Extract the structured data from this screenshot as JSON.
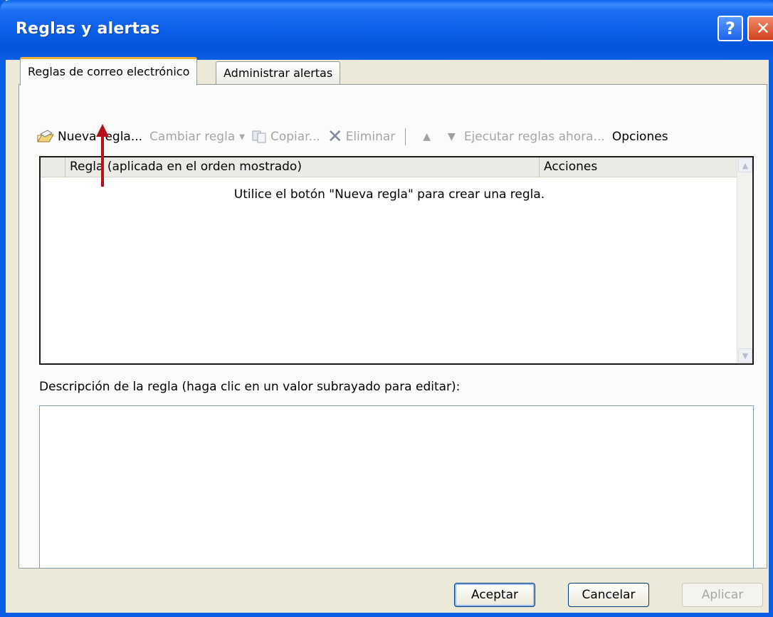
{
  "window": {
    "title": "Reglas y alertas",
    "help_label": "?",
    "close_label": "✕"
  },
  "tabs": [
    {
      "label": "Reglas de correo electrónico",
      "active": true
    },
    {
      "label": "Administrar alertas",
      "active": false
    }
  ],
  "toolbar": {
    "new_rule": "Nueva regla...",
    "change_rule": "Cambiar regla",
    "copy": "Copiar...",
    "delete": "Eliminar",
    "run_rules": "Ejecutar reglas ahora...",
    "options": "Opciones"
  },
  "list": {
    "columns": [
      "Regla (aplicada en el orden mostrado)",
      "Acciones"
    ],
    "empty_message": "Utilice el botón \"Nueva regla\" para crear una regla."
  },
  "description": {
    "label": "Descripción de la regla (haga clic en un valor subrayado para editar):",
    "text": ""
  },
  "buttons": {
    "ok": "Aceptar",
    "cancel": "Cancelar",
    "apply": "Aplicar"
  },
  "colors": {
    "titlebar": "#0a5ee6",
    "face": "#ece9d8",
    "annotation_arrow": "#b3121a"
  }
}
